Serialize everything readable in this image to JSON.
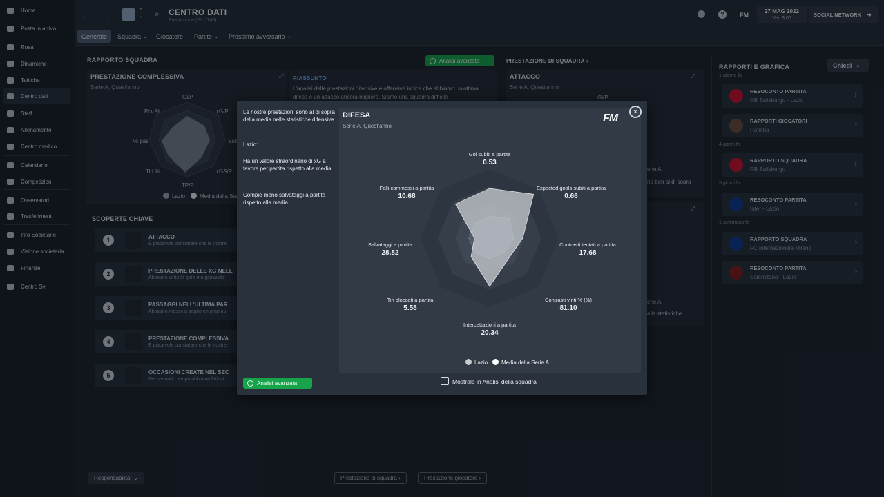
{
  "sidebar": {
    "items": [
      {
        "label": "Home",
        "icon": "home-icon"
      },
      {
        "label": "Posta in arrivo",
        "icon": "inbox-icon"
      },
      {
        "label": "Rosa",
        "icon": "shirt-icon"
      },
      {
        "label": "Dinamiche",
        "icon": "dynamics-icon"
      },
      {
        "label": "Tattiche",
        "icon": "tactics-icon"
      },
      {
        "label": "Centro dati",
        "icon": "data-icon"
      },
      {
        "label": "Staff",
        "icon": "staff-icon"
      },
      {
        "label": "Allenamento",
        "icon": "training-icon"
      },
      {
        "label": "Centro medico",
        "icon": "medical-icon"
      },
      {
        "label": "Calendario",
        "icon": "calendar-icon"
      },
      {
        "label": "Competizioni",
        "icon": "trophy-icon"
      },
      {
        "label": "Osservatori",
        "icon": "search-icon"
      },
      {
        "label": "Trasferimenti",
        "icon": "transfer-icon"
      },
      {
        "label": "Info Societarie",
        "icon": "shield-icon"
      },
      {
        "label": "Visione societaria",
        "icon": "vision-icon"
      },
      {
        "label": "Finanze",
        "icon": "finance-icon"
      },
      {
        "label": "Centro Sv.",
        "icon": "development-icon"
      }
    ]
  },
  "header": {
    "title": "CENTRO DATI",
    "subtitle": "Prestazione (ID: 1140)",
    "date": "27 MAG 2022",
    "time": "Ven 8:00",
    "social": "SOCIAL NETWORK",
    "fm": "FM"
  },
  "tabs": [
    "Generale",
    "Squadra",
    "Giocatore",
    "Partite",
    "Prossimo avversario"
  ],
  "left": {
    "section": "RAPPORTO SQUADRA",
    "overall_title": "PRESTAZIONE COMPLESSIVA",
    "overall_sub": "Serie A, Quest'anno",
    "radar_labels": [
      "Gl/P",
      "xG/P",
      "Sub",
      "xGS/P",
      "TP/P",
      "Tiri %",
      "% pas",
      "Pcv %"
    ],
    "legend_lazio": "Lazio",
    "legend_media": "Media della Ser",
    "summary_title": "RIASSUNTO",
    "summary_text": "L'analisi delle prestazioni difensive e offensive indica che abbiamo un'ottima difesa e un attacco ancora migliore. Siamo una squadra difficile",
    "advanced": "Analisi avanzata",
    "findings_title": "SCOPERTE CHIAVE",
    "findings": [
      {
        "n": "1",
        "title": "ATTACCO",
        "desc": "È piacevole constatare che le nostre"
      },
      {
        "n": "2",
        "title": "PRESTAZIONE DELLE XG NELL",
        "desc": "Abbiamo vinto la gara ma giocando"
      },
      {
        "n": "3",
        "title": "PASSAGGI NELL'ULTIMA PAR",
        "desc": "Abbiamo messo a segno un gran nu"
      },
      {
        "n": "4",
        "title": "PRESTAZIONE COMPLESSIVA",
        "desc": "È piacevole constatare che le nostre"
      },
      {
        "n": "5",
        "title": "OCCASIONI CREATE NEL SEC",
        "desc": "Nel secondo tempo abbiamo faticat"
      }
    ],
    "resp": "Responsabilità"
  },
  "middle": {
    "section": "PRESTAZIONE DI SQUADRA",
    "attack_title": "ATTACCO",
    "attack_sub": "Serie A, Quest'anno",
    "attack_label": "Gl/P",
    "peek1": "erie A",
    "peek2": "no ben al di sopra",
    "peek3": "erie A",
    "peek4": "alle statistiche"
  },
  "footer": {
    "btn_team": "Prestazione di squadra",
    "btn_player": "Prestazione giocatore"
  },
  "right": {
    "title": "RAPPORTI E GRAFICA",
    "ask": "Chiedi",
    "groups": [
      {
        "when": "1 giorno fa",
        "items": [
          {
            "title": "RESOCONTO PARTITA",
            "sub": "RB Salisburgo - Lazio",
            "logo": "#c8102e"
          },
          {
            "title": "RAPPORTI GIOCATORI",
            "sub": "Rafinha",
            "logo": "#6b4a3a"
          }
        ]
      },
      {
        "when": "4 giorni fa",
        "items": [
          {
            "title": "RAPPORTO SQUADRA",
            "sub": "RB Salisburgo",
            "logo": "#c8102e"
          }
        ]
      },
      {
        "when": "5 giorni fa",
        "items": [
          {
            "title": "RESOCONTO PARTITA",
            "sub": "Inter - Lazio",
            "logo": "#0a3a8c"
          }
        ]
      },
      {
        "when": "1 settimana fa",
        "items": [
          {
            "title": "RAPPORTO SQUADRA",
            "sub": "FC Internazionale Milano",
            "logo": "#0a3a8c"
          },
          {
            "title": "RESOCONTO PARTITA",
            "sub": "Salernitana - Lazio",
            "logo": "#7a1a1a"
          }
        ]
      }
    ]
  },
  "modal": {
    "intro": "Le nostre prestazioni sono al di sopra della media nelle statistiche difensive.",
    "club": "Lazio:",
    "p1": "Ha un valore straordinario di xG a favore per partita rispetto alla media.",
    "p2": "Compie meno salvataggi a partita rispetto alla media.",
    "advanced": "Analisi avanzata",
    "title": "DIFESA",
    "sub": "Serie A, Quest'anno",
    "logo": "FM",
    "checkbox": "Mostralo in Analisi della squadra",
    "legend_lazio": "Lazio",
    "legend_media": "Media della Serie A"
  },
  "chart_data": {
    "type": "radar",
    "title": "DIFESA",
    "subtitle": "Serie A, Quest'anno",
    "axes": [
      {
        "label": "Gol subiti a partita",
        "value": "0.53",
        "lazio": 0.72,
        "media": 0.32
      },
      {
        "label": "Expected goals subiti a partita",
        "value": "0.66",
        "lazio": 0.9,
        "media": 0.4
      },
      {
        "label": "Contrasti tentati a partita",
        "value": "17.68",
        "lazio": 0.48,
        "media": 0.35
      },
      {
        "label": "Contrasti vinti % (%)",
        "value": "81.10",
        "lazio": 0.4,
        "media": 0.3
      },
      {
        "label": "Intercettazioni a partita",
        "value": "20.34",
        "lazio": 0.7,
        "media": 0.3
      },
      {
        "label": "Tiri bloccati a partita",
        "value": "5.58",
        "lazio": 0.38,
        "media": 0.3
      },
      {
        "label": "Salvataggi a partita",
        "value": "28.82",
        "lazio": 0.22,
        "media": 0.3
      },
      {
        "label": "Falli commessi a partita",
        "value": "10.68",
        "lazio": 0.7,
        "media": 0.3
      }
    ],
    "series": [
      {
        "name": "Lazio",
        "color": "#c9ccd1"
      },
      {
        "name": "Media della Serie A",
        "color": "#ffffff"
      }
    ],
    "legend": "bottom"
  }
}
